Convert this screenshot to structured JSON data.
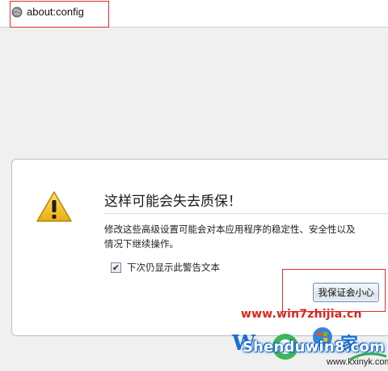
{
  "address_bar": {
    "url": "about:config",
    "icon": "globe-icon"
  },
  "warning_dialog": {
    "icon": "warning-triangle-icon",
    "title": "这样可能会失去质保！",
    "message_lines": [
      "修改这些高级设置可能会对本应用程序的稳定性、安全性以及",
      "情况下继续操作。"
    ],
    "checkbox": {
      "label": "下次仍显示此警告文本",
      "checked": true
    },
    "confirm_button": "我保证会小心"
  },
  "watermark": {
    "url": "www.win7zhijia.cn",
    "brand": "Shenduwin8.com",
    "sub": "www.kxinyk.com"
  },
  "colors": {
    "annotation_red": "#e12b2b",
    "warning_yellow": "#f2c21a",
    "watermark_red": "#e0241c",
    "watermark_blue": "#1a6fd3"
  }
}
